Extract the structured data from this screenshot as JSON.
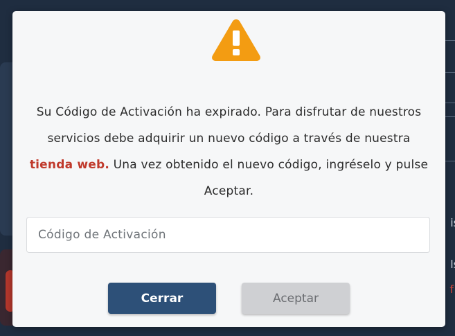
{
  "dialog": {
    "icon": "warning-triangle-icon",
    "message": {
      "before_link": "Su Código de Activación ha expirado. Para disfrutar de nuestros servicios debe adquirir un nuevo código a través de nuestra ",
      "link_text": "tienda web.",
      "after_link": " Una vez obtenido el nuevo código, ingréselo y pulse Aceptar."
    },
    "code_input": {
      "placeholder": "Código de Activación",
      "value": ""
    },
    "buttons": {
      "close_label": "Cerrar",
      "accept_label": "Aceptar"
    }
  },
  "background": {
    "partial_texts": [
      "is",
      "ls",
      "f"
    ]
  },
  "colors": {
    "warning": "#f39c12",
    "link": "#c0392b",
    "primary_button": "#2d5078",
    "disabled_button": "#cfd0d3",
    "backdrop": "#1f2d40"
  }
}
